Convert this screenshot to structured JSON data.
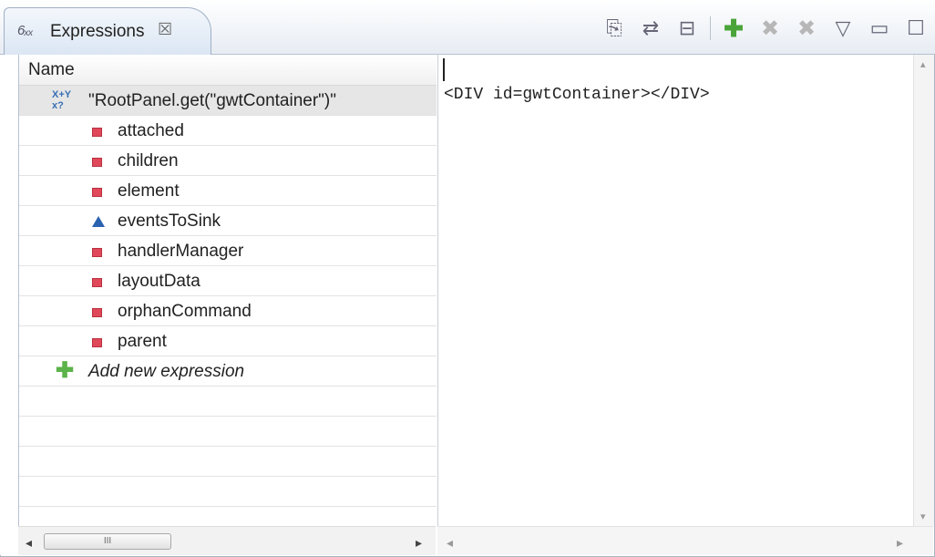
{
  "view_tab": {
    "icon": "expressions-view-icon",
    "title": "Expressions",
    "close": "☒"
  },
  "toolbar": [
    {
      "name": "select-all-expressions-button",
      "glyph": "⎘",
      "style": "normal"
    },
    {
      "name": "collapse-expand-button",
      "glyph": "⇄",
      "style": "normal"
    },
    {
      "name": "collapse-all-button",
      "glyph": "⊟",
      "style": "normal"
    },
    {
      "name": "add-watch-expression-button",
      "glyph": "✚",
      "style": "green"
    },
    {
      "name": "remove-expression-button",
      "glyph": "✖",
      "style": "gray"
    },
    {
      "name": "remove-all-expressions-button",
      "glyph": "✖",
      "style": "gray"
    },
    {
      "name": "view-menu-button",
      "glyph": "▽",
      "style": "normal"
    },
    {
      "name": "minimize-button",
      "glyph": "▭",
      "style": "normal"
    },
    {
      "name": "maximize-button",
      "glyph": "☐",
      "style": "normal"
    }
  ],
  "tree": {
    "column_header": "Name",
    "root": {
      "icon": "watch-expression-icon",
      "icon_text": "X+Y\nx?",
      "label": "\"RootPanel.get(\"gwtContainer\")\""
    },
    "children": [
      {
        "label": "attached",
        "icon": "private-field-icon"
      },
      {
        "label": "children",
        "icon": "private-field-icon"
      },
      {
        "label": "element",
        "icon": "private-field-icon"
      },
      {
        "label": "eventsToSink",
        "icon": "protected-field-icon"
      },
      {
        "label": "handlerManager",
        "icon": "private-field-icon"
      },
      {
        "label": "layoutData",
        "icon": "private-field-icon"
      },
      {
        "label": "orphanCommand",
        "icon": "private-field-icon"
      },
      {
        "label": "parent",
        "icon": "private-field-icon"
      }
    ],
    "add_new": "Add new expression",
    "empty_rows": 5
  },
  "detail": {
    "text": "<DIV id=gwtContainer></DIV>"
  },
  "scrollbar": {
    "thumb_grip": "III",
    "left_arrow": "◂",
    "right_arrow": "▸",
    "up_arrow": "▴",
    "down_arrow": "▾"
  }
}
